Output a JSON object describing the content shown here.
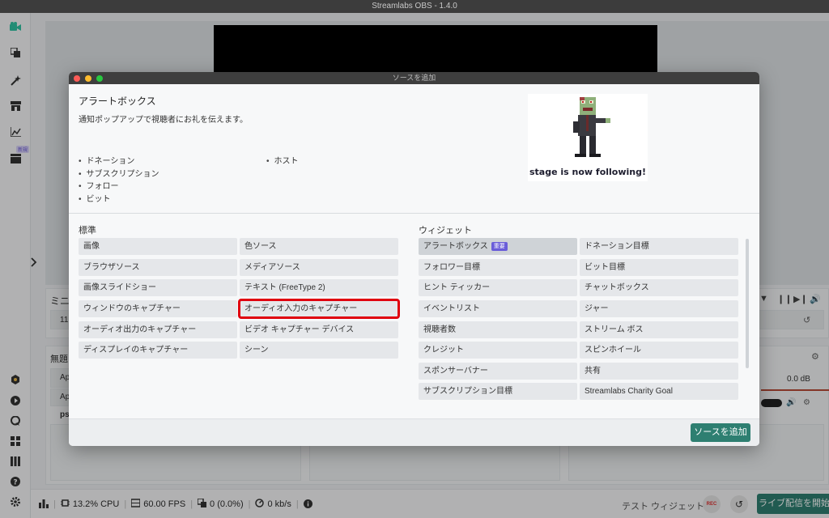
{
  "window": {
    "title": "Streamlabs OBS - 1.4.0"
  },
  "sidebar": {
    "new_badge": "新規"
  },
  "background": {
    "mini_label": "ミニ",
    "mini_row_text": "11",
    "scenes_label": "無題",
    "row1": "Ap",
    "row2": "Ap",
    "row3": "ps",
    "mixer_db": "0.0 dB"
  },
  "statusbar": {
    "cpu": "13.2% CPU",
    "fps": "60.00 FPS",
    "dropped": "0 (0.0%)",
    "bitrate": "0 kb/s",
    "test_widget": "テスト ウィジェット",
    "rec": "REC",
    "go_live": "ライブ配信を開始する"
  },
  "modal": {
    "title": "ソースを追加",
    "info": {
      "title": "アラートボックス",
      "description": "通知ポップアップで視聴者にお礼を伝えます。",
      "bullets_left": [
        "ドネーション",
        "サブスクリプション",
        "フォロー",
        "ビット"
      ],
      "bullets_right": [
        "ホスト"
      ],
      "preview_caption": "stage is now following!"
    },
    "standard": {
      "label": "標準",
      "col1": [
        "画像",
        "ブラウザソース",
        "画像スライドショー",
        "ウィンドウのキャプチャー",
        "オーディオ出力のキャプチャー",
        "ディスプレイのキャプチャー"
      ],
      "col2": [
        "色ソース",
        "メディアソース",
        "テキスト (FreeType 2)",
        "オーディオ入力のキャプチャー",
        "ビデオ キャプチャー デバイス",
        "シーン"
      ]
    },
    "widgets": {
      "label": "ウィジェット",
      "important_badge": "重要",
      "col1": [
        "アラートボックス",
        "フォロワー目標",
        "ヒント ティッカー",
        "イベントリスト",
        "視聴者数",
        "クレジット",
        "スポンサーバナー",
        "サブスクリプション目標"
      ],
      "col2": [
        "ドネーション目標",
        "ビット目標",
        "チャットボックス",
        "ジャー",
        "ストリーム ボス",
        "スピンホイール",
        "共有",
        "Streamlabs Charity Goal"
      ]
    },
    "add_button": "ソースを追加"
  },
  "colors": {
    "accent": "#2e7f71",
    "active_icon": "#31c3a2",
    "highlight_border": "#e0000f",
    "important_badge": "#6a5dd9"
  }
}
